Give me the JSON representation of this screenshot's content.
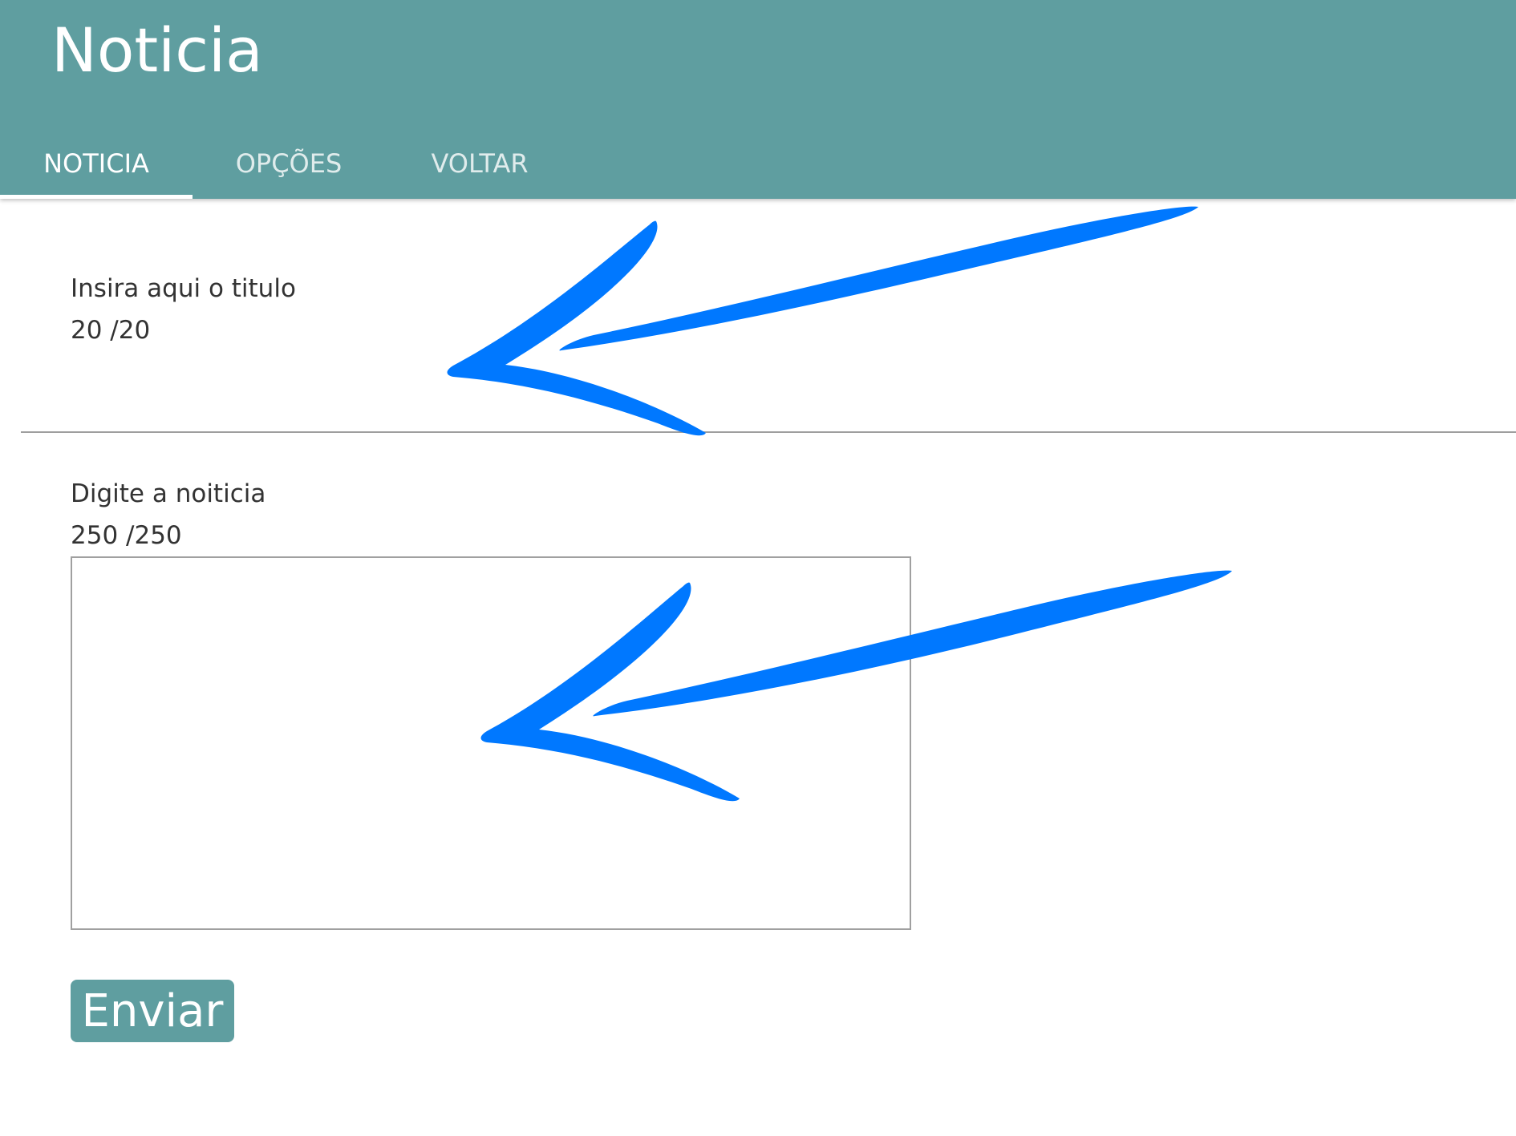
{
  "header": {
    "title": "Noticia"
  },
  "tabs": [
    {
      "label": "NOTICIA",
      "active": true
    },
    {
      "label": "OPÇÕES",
      "active": false
    },
    {
      "label": "VOLTAR",
      "active": false
    }
  ],
  "form": {
    "title_field": {
      "label": "Insira aqui o titulo",
      "counter": "20 /20",
      "value": ""
    },
    "news_field": {
      "label": "Digite a noiticia",
      "counter": "250 /250",
      "value": ""
    },
    "submit_label": "Enviar"
  },
  "annotations": {
    "arrow_color": "#0078ff"
  },
  "colors": {
    "primary": "#5f9ea0",
    "text": "#333333",
    "border": "#a0a0a0"
  }
}
